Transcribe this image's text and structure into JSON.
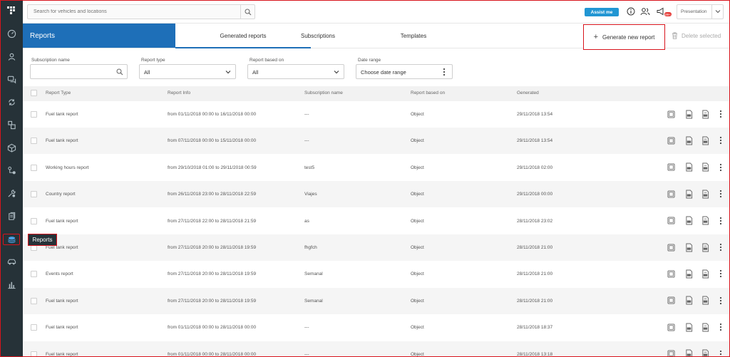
{
  "topbar": {
    "search_placeholder": "Search for vehicles and locations",
    "assist_label": "Assist me",
    "notification_badge": "99+",
    "presentation_label": "Presentation"
  },
  "sidebar": {
    "items": [
      "dashboard",
      "drivers",
      "messages",
      "routes",
      "tasks",
      "objects",
      "tracking",
      "maintenance",
      "documents",
      "reports",
      "vehicles",
      "statistics"
    ],
    "tooltip": "Reports"
  },
  "header": {
    "title": "Reports",
    "tabs": [
      {
        "label": "Generated reports",
        "active": true
      },
      {
        "label": "Subscriptions",
        "active": false
      },
      {
        "label": "Templates",
        "active": false
      }
    ],
    "generate_label": "Generate new report",
    "delete_label": "Delete selected"
  },
  "filters": {
    "subscription_name": {
      "label": "Subscription name",
      "value": ""
    },
    "report_type": {
      "label": "Report type",
      "value": "All"
    },
    "based_on": {
      "label": "Report based on",
      "value": "All"
    },
    "date_range": {
      "label": "Date range",
      "value": "Choose date range"
    }
  },
  "table": {
    "columns": [
      "Report Type",
      "Report Info",
      "Subscription name",
      "Report based on",
      "Generated"
    ],
    "rows": [
      {
        "type": "Fuel tank report",
        "info": "from 01/11/2018 00:00 to 16/11/2018 00:00",
        "subscription": "---",
        "based_on": "Object",
        "generated": "29/11/2018 13:54"
      },
      {
        "type": "Fuel tank report",
        "info": "from 07/11/2018 00:00 to 15/11/2018 00:00",
        "subscription": "---",
        "based_on": "Object",
        "generated": "29/11/2018 13:54"
      },
      {
        "type": "Working hours report",
        "info": "from 29/10/2018 01:00 to 29/11/2018 00:59",
        "subscription": "test5",
        "based_on": "Object",
        "generated": "29/11/2018 02:00"
      },
      {
        "type": "Country report",
        "info": "from 26/11/2018 23:00 to 28/11/2018 22:59",
        "subscription": "Viajes",
        "based_on": "Object",
        "generated": "29/11/2018 00:00"
      },
      {
        "type": "Fuel tank report",
        "info": "from 27/11/2018 22:00 to 28/11/2018 21:59",
        "subscription": "as",
        "based_on": "Object",
        "generated": "28/11/2018 23:02"
      },
      {
        "type": "Fuel tank report",
        "info": "from 27/11/2018 20:00 to 28/11/2018 19:59",
        "subscription": "fhgfch",
        "based_on": "Object",
        "generated": "28/11/2018 21:00"
      },
      {
        "type": "Events report",
        "info": "from 27/11/2018 20:00 to 28/11/2018 19:59",
        "subscription": "Semanal",
        "based_on": "Object",
        "generated": "28/11/2018 21:00"
      },
      {
        "type": "Fuel tank report",
        "info": "from 27/11/2018 20:00 to 28/11/2018 19:59",
        "subscription": "Semanal",
        "based_on": "Object",
        "generated": "28/11/2018 21:00"
      },
      {
        "type": "Fuel tank report",
        "info": "from 01/11/2018 00:00 to 28/11/2018 00:00",
        "subscription": "---",
        "based_on": "Object",
        "generated": "28/11/2018 18:37"
      },
      {
        "type": "Fuel tank report",
        "info": "from 01/11/2018 00:00 to 28/11/2018 00:00",
        "subscription": "---",
        "based_on": "Object",
        "generated": "28/11/2018 13:18"
      }
    ]
  },
  "colors": {
    "brand": "#1e6fb8",
    "sidebar": "#263238",
    "assist": "#2196d3",
    "highlight": "#d8141c"
  }
}
